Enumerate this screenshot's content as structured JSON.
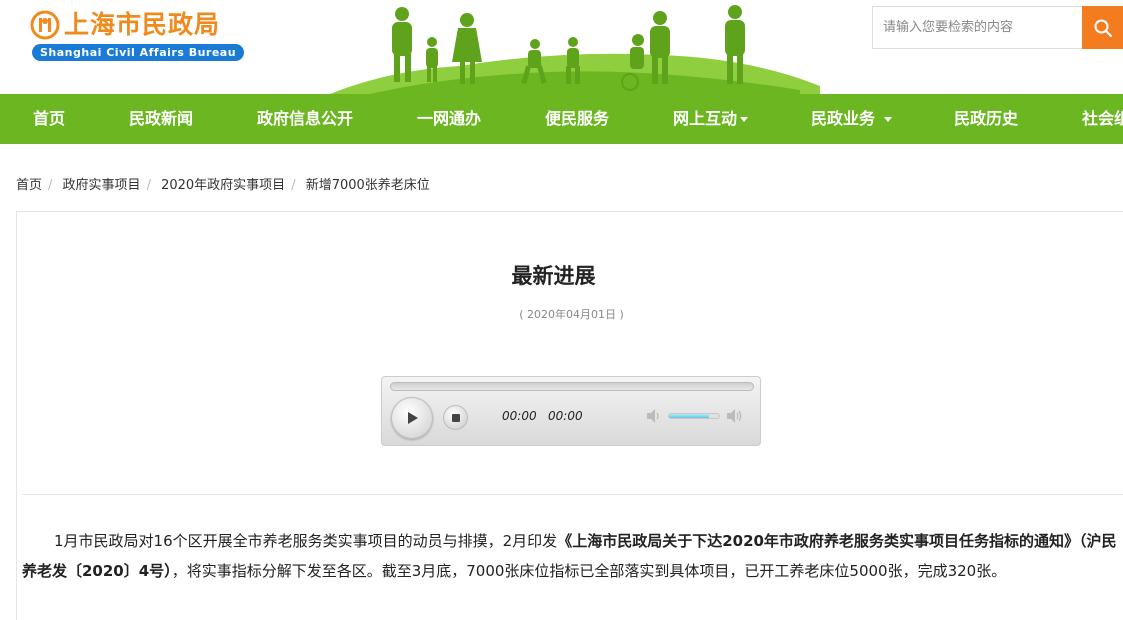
{
  "header": {
    "logo_cn": "上海市民政局",
    "logo_en": "Shanghai Civil Affairs Bureau",
    "search_placeholder": "请输入您要检索的内容",
    "brand_orange": "#f08a1c",
    "brand_blue": "#1a7bd6",
    "search_button_color": "#f47c20"
  },
  "nav": {
    "color": "#6bb621",
    "items": [
      {
        "label": "首页",
        "dropdown": false
      },
      {
        "label": "民政新闻",
        "dropdown": false
      },
      {
        "label": "政府信息公开",
        "dropdown": false
      },
      {
        "label": "一网通办",
        "dropdown": false
      },
      {
        "label": "便民服务",
        "dropdown": false
      },
      {
        "label": "网上互动",
        "dropdown": true
      },
      {
        "label": "民政业务",
        "dropdown": true
      },
      {
        "label": "民政历史",
        "dropdown": false
      },
      {
        "label": "社会组",
        "dropdown": false
      }
    ]
  },
  "breadcrumb": [
    "首页",
    "政府实事项目",
    "2020年政府实事项目",
    "新增7000张养老床位"
  ],
  "article": {
    "title": "最新进展",
    "date": "( 2020年04月01日 )",
    "body_part1": "1月市民政局对16个区开展全市养老服务类实事项目的动员与排摸，2月印发",
    "body_bold": "《上海市民政局关于下达2020年市政府养老服务类实事项目任务指标的通知》（沪民养老发〔2020〕4号）",
    "body_part2": "，将实事指标分解下发至各区。截至3月底，7000张床位指标已全部落实到具体项目，已开工养老床位5000张，完成320张。"
  },
  "player": {
    "current_time": "00:00",
    "duration": "00:00",
    "volume": 0.8
  }
}
